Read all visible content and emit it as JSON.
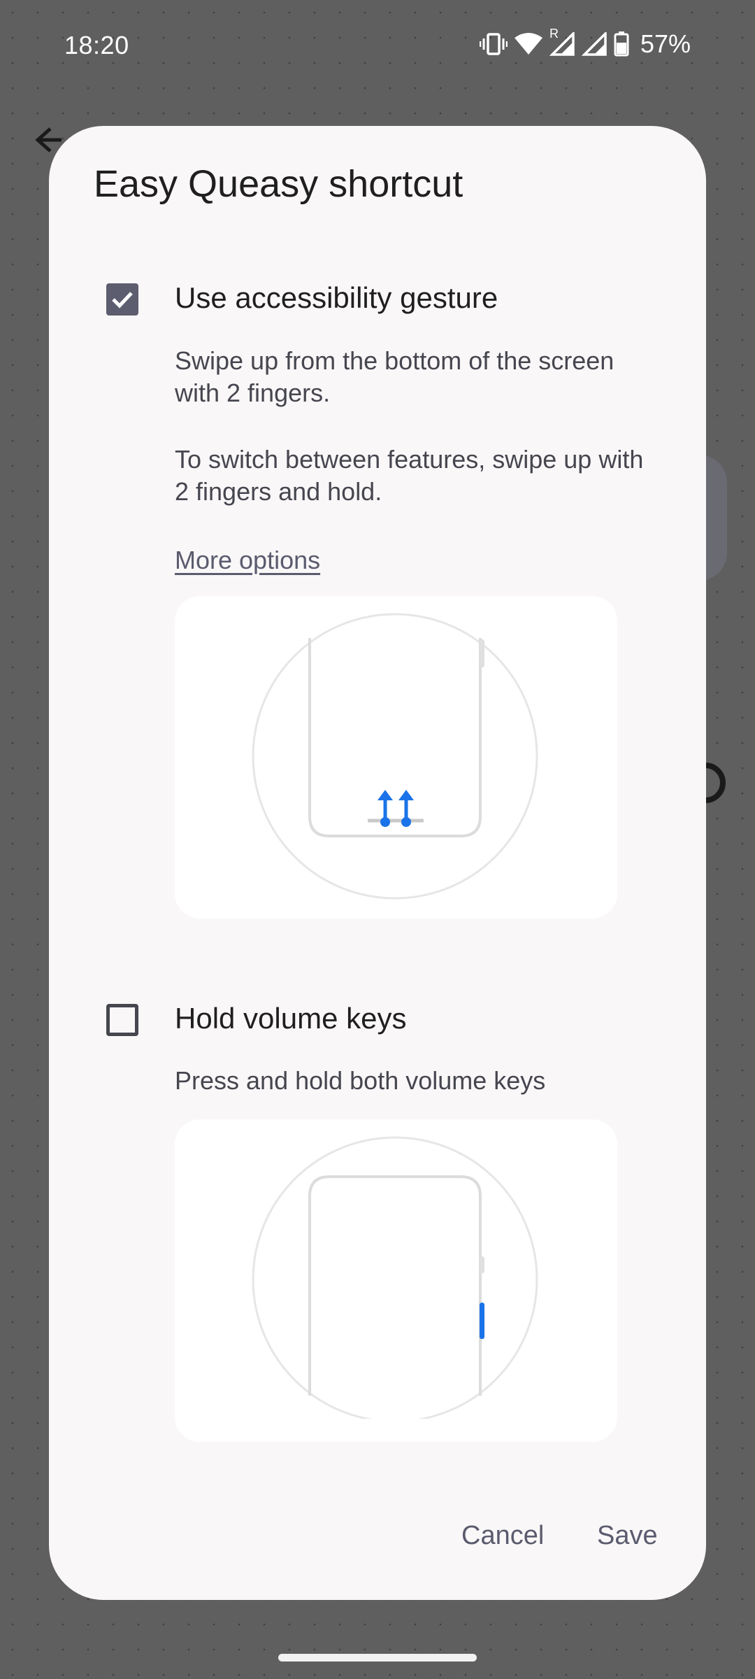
{
  "status_bar": {
    "time": "18:20",
    "battery": "57%",
    "roaming_indicator": "R",
    "icons": [
      "vibrate-icon",
      "wifi-icon",
      "signal-roaming-icon",
      "signal-icon",
      "battery-icon"
    ]
  },
  "dialog": {
    "title": "Easy Queasy shortcut",
    "options": [
      {
        "label": "Use accessibility gesture",
        "checked": true,
        "description_1": "Swipe up from the bottom of the screen with 2 fingers.",
        "description_2": "To switch between features, swipe up with 2 fingers and hold.",
        "link": "More options",
        "illustration": "two-finger-swipe-illustration"
      },
      {
        "label": "Hold volume keys",
        "checked": false,
        "description_1": "Press and hold both volume keys",
        "illustration": "volume-keys-illustration"
      }
    ],
    "buttons": {
      "cancel": "Cancel",
      "save": "Save"
    }
  },
  "colors": {
    "accent": "#5c5d6e",
    "illustration_blue": "#1a73e8",
    "dialog_bg": "#faf7f8",
    "scrim": "#5f5f60"
  }
}
